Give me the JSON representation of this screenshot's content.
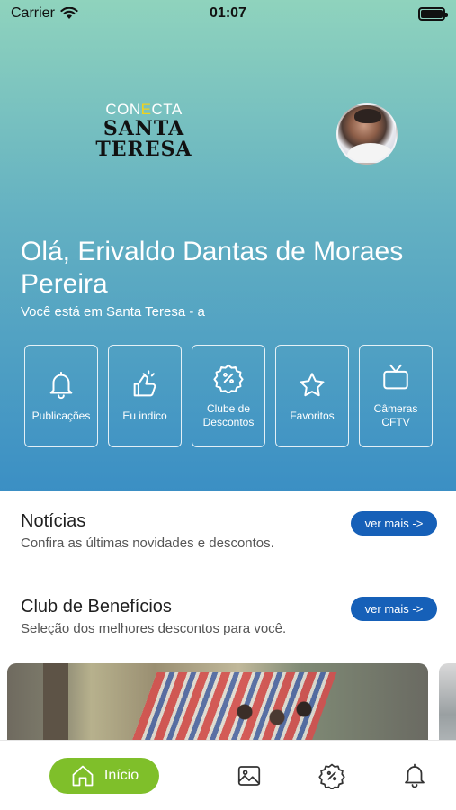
{
  "status_bar": {
    "carrier": "Carrier",
    "time": "01:07"
  },
  "header": {
    "logo": {
      "top": "CONECTA",
      "line1": "SANTA",
      "line2": "TERESA"
    },
    "greeting": "Olá, Erivaldo Dantas de Moraes Pereira",
    "location": "Você está em Santa Teresa - a"
  },
  "shortcuts": [
    {
      "label": "Publicações",
      "icon": "bell-icon"
    },
    {
      "label": "Eu indico",
      "icon": "thumbs-up-icon"
    },
    {
      "label": "Clube de Descontos",
      "icon": "discount-badge-icon"
    },
    {
      "label": "Favoritos",
      "icon": "star-icon"
    },
    {
      "label": "Câmeras CFTV",
      "icon": "tv-icon"
    }
  ],
  "news": {
    "title": "Notícias",
    "subtitle": "Confira as últimas novidades e descontos.",
    "button": "ver mais ->"
  },
  "benefits": {
    "title": "Club de Benefícios",
    "subtitle": "Seleção dos melhores descontos para você.",
    "button": "ver mais ->"
  },
  "tabbar": {
    "active_label": "Início",
    "items": [
      "home-icon",
      "image-icon",
      "discount-badge-icon",
      "bell-icon"
    ]
  },
  "colors": {
    "accent_green": "#7fbf2a",
    "button_blue": "#1660b8",
    "hero_top": "#8fd3bd",
    "hero_bottom": "#3b8fc4"
  }
}
